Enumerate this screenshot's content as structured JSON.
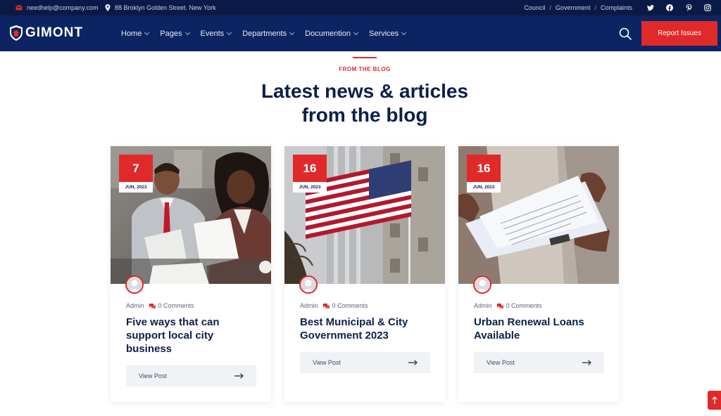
{
  "topbar": {
    "email": "needhelp@company.com",
    "address": "88 Broklyn Golden Street. New York",
    "links": [
      "Council",
      "Government",
      "Complaints"
    ],
    "separator": "/",
    "socials": [
      "twitter-icon",
      "facebook-icon",
      "pinterest-icon",
      "instagram-icon"
    ]
  },
  "header": {
    "logo_text": "GIMONT",
    "nav": [
      "Home",
      "Pages",
      "Events",
      "Departments",
      "Documention",
      "Services"
    ],
    "report_button": "Report Issues"
  },
  "section": {
    "eyebrow": "FROM THE BLOG",
    "title_line1": "Latest news & articles",
    "title_line2": "from the blog"
  },
  "posts": [
    {
      "day": "7",
      "month": "JUN, 2023",
      "author": "Admin",
      "comments": "0 Comments",
      "title": "Five ways that can support local city business",
      "button": "View Post",
      "image": "business-people-photo"
    },
    {
      "day": "16",
      "month": "JUN, 2023",
      "author": "Admin",
      "comments": "0 Comments",
      "title": "Best Municipal & City Government 2023",
      "button": "View Post",
      "image": "american-flag-photo"
    },
    {
      "day": "16",
      "month": "JUN, 2023",
      "author": "Admin",
      "comments": "0 Comments",
      "title": "Urban Renewal Loans Available",
      "button": "View Post",
      "image": "documents-photo"
    }
  ],
  "colors": {
    "navy": "#0d2462",
    "topbar": "#0a1a47",
    "accent": "#e02a2a",
    "title": "#0d1f4a"
  }
}
